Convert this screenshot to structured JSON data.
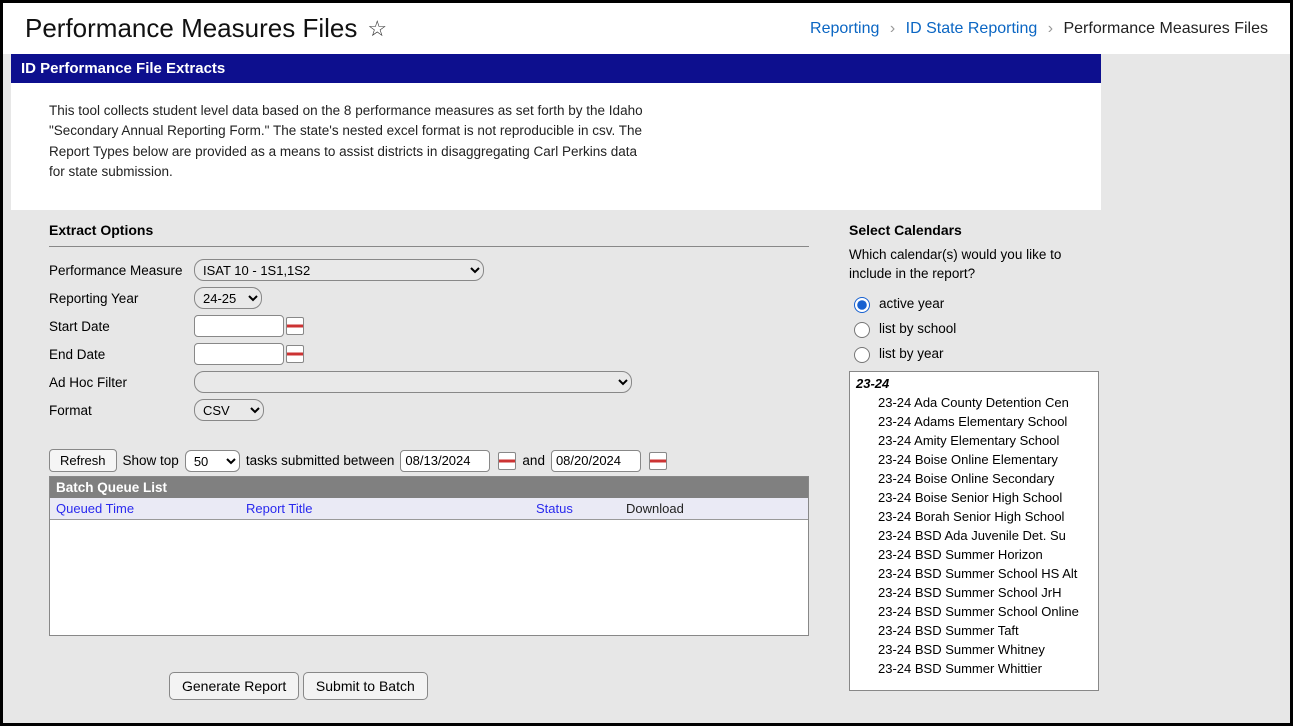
{
  "header": {
    "title": "Performance Measures Files",
    "breadcrumb": {
      "l1": "Reporting",
      "l2": "ID State Reporting",
      "l3": "Performance Measures Files"
    }
  },
  "banner": "ID Performance File Extracts",
  "description": "This tool collects student level data based on the 8 performance measures as set forth by the Idaho \"Secondary Annual Reporting Form.\" The state's nested excel format is not reproducible in csv. The Report Types below are provided as a means to assist districts in disaggregating Carl Perkins data for state submission.",
  "extract": {
    "section_title": "Extract Options",
    "labels": {
      "perf": "Performance Measure",
      "year": "Reporting Year",
      "start": "Start Date",
      "end": "End Date",
      "filter": "Ad Hoc Filter",
      "format": "Format"
    },
    "values": {
      "perf": "ISAT 10 - 1S1,1S2",
      "year": "24-25",
      "start": "",
      "end": "",
      "filter": "",
      "format": "CSV"
    }
  },
  "batch": {
    "refresh": "Refresh",
    "show_top_label": "Show top",
    "show_top_value": "50",
    "tasks_label": "tasks submitted between",
    "and_label": "and",
    "date_from": "08/13/2024",
    "date_to": "08/20/2024",
    "list_title": "Batch Queue List",
    "cols": {
      "c1": "Queued Time",
      "c2": "Report Title",
      "c3": "Status",
      "c4": "Download"
    }
  },
  "actions": {
    "generate": "Generate Report",
    "submit": "Submit to Batch"
  },
  "calendars": {
    "title": "Select Calendars",
    "question": "Which calendar(s) would you like to include in the report?",
    "options": {
      "active": "active year",
      "school": "list by school",
      "year": "list by year"
    },
    "selected": "active",
    "group": "23-24",
    "items": [
      "23-24 Ada County Detention Cen",
      "23-24 Adams Elementary School",
      "23-24 Amity Elementary School",
      "23-24 Boise Online Elementary",
      "23-24 Boise Online Secondary",
      "23-24 Boise Senior High School",
      "23-24 Borah Senior High School",
      "23-24 BSD Ada Juvenile Det. Su",
      "23-24 BSD Summer Horizon",
      "23-24 BSD Summer School HS Alt",
      "23-24 BSD Summer School JrH",
      "23-24 BSD Summer School Online",
      "23-24 BSD Summer Taft",
      "23-24 BSD Summer Whitney",
      "23-24 BSD Summer Whittier"
    ]
  }
}
